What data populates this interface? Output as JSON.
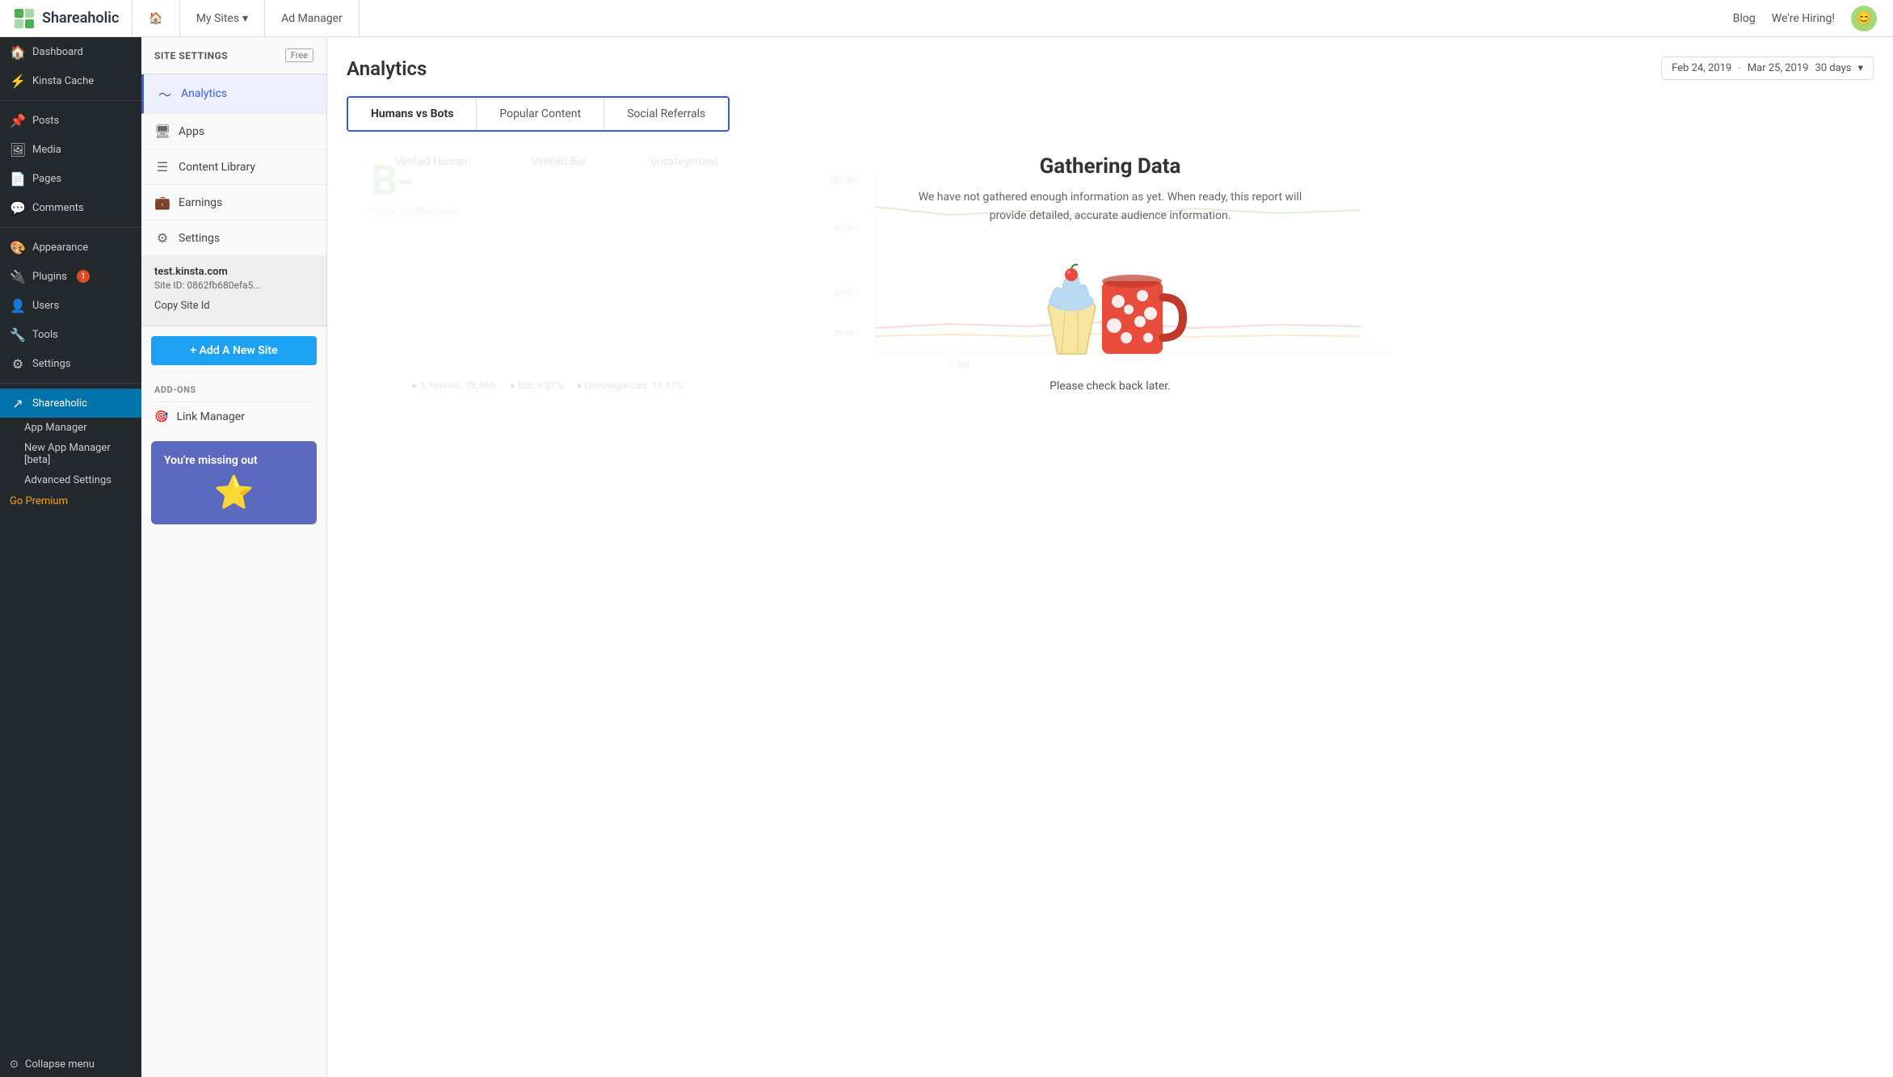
{
  "topnav": {
    "logo_text": "Shareaholic",
    "home_icon": "🏠",
    "my_sites_label": "My Sites",
    "ad_manager_label": "Ad Manager",
    "blog_label": "Blog",
    "hiring_label": "We're Hiring!",
    "avatar_emoji": "😊"
  },
  "wp_sidebar": {
    "items": [
      {
        "label": "Dashboard",
        "icon": "🏠",
        "active": false
      },
      {
        "label": "Kinsta Cache",
        "icon": "⚡",
        "active": false
      },
      {
        "label": "Posts",
        "icon": "📌",
        "active": false
      },
      {
        "label": "Media",
        "icon": "🖼",
        "active": false
      },
      {
        "label": "Pages",
        "icon": "📄",
        "active": false
      },
      {
        "label": "Comments",
        "icon": "💬",
        "active": false
      },
      {
        "label": "Appearance",
        "icon": "🎨",
        "active": false
      },
      {
        "label": "Plugins",
        "icon": "🔌",
        "active": false,
        "badge": "1"
      },
      {
        "label": "Users",
        "icon": "👤",
        "active": false
      },
      {
        "label": "Tools",
        "icon": "🔧",
        "active": false
      },
      {
        "label": "Settings",
        "icon": "⚙",
        "active": false
      },
      {
        "label": "Shareaholic",
        "icon": "↗",
        "active": true
      }
    ],
    "sub_items": [
      {
        "label": "App Manager",
        "active": false
      },
      {
        "label": "New App Manager [beta]",
        "active": false
      },
      {
        "label": "Advanced Settings",
        "active": false
      }
    ],
    "go_premium": "Go Premium",
    "collapse_menu": "Collapse menu"
  },
  "plugin_panel": {
    "title": "SITE SETTINGS",
    "free_badge": "Free",
    "nav_items": [
      {
        "label": "Analytics",
        "icon": "📈",
        "active": true
      },
      {
        "label": "Apps",
        "icon": "🖥",
        "active": false
      },
      {
        "label": "Content Library",
        "icon": "☰",
        "active": false
      },
      {
        "label": "Earnings",
        "icon": "💼",
        "active": false
      },
      {
        "label": "Settings",
        "icon": "⚙",
        "active": false
      }
    ],
    "site_domain": "test.kinsta.com",
    "site_id_label": "Site ID:",
    "site_id_value": "0862fb680efa5...",
    "copy_site_id": "Copy Site Id",
    "add_site_label": "+ Add A New Site",
    "addons_title": "ADD-ONS",
    "addon_items": [
      {
        "label": "Link Manager",
        "icon": "🎯"
      }
    ],
    "promo_text": "You're missing out"
  },
  "main_content": {
    "title": "Analytics",
    "date_from": "Feb 24, 2019",
    "date_sep": "-",
    "date_to": "Mar 25, 2019",
    "date_range": "30 days",
    "tabs": [
      {
        "label": "Humans vs Bots",
        "active": true
      },
      {
        "label": "Popular Content",
        "active": false
      },
      {
        "label": "Social Referrals",
        "active": false
      }
    ],
    "chart": {
      "grade_letter": "B-",
      "grade_label": "Traffic Quality Grade",
      "legend_items": [
        "% Human",
        "% Bot",
        "Uncategorized"
      ],
      "col_labels": [
        "Verified Human",
        "Verified Bot",
        "Uncategorized"
      ]
    },
    "gathering_title": "Gathering Data",
    "gathering_desc": "We have not gathered enough information as yet. When ready, this report will provide detailed, accurate audience information.",
    "gathering_subtitle": "Please check back later."
  }
}
